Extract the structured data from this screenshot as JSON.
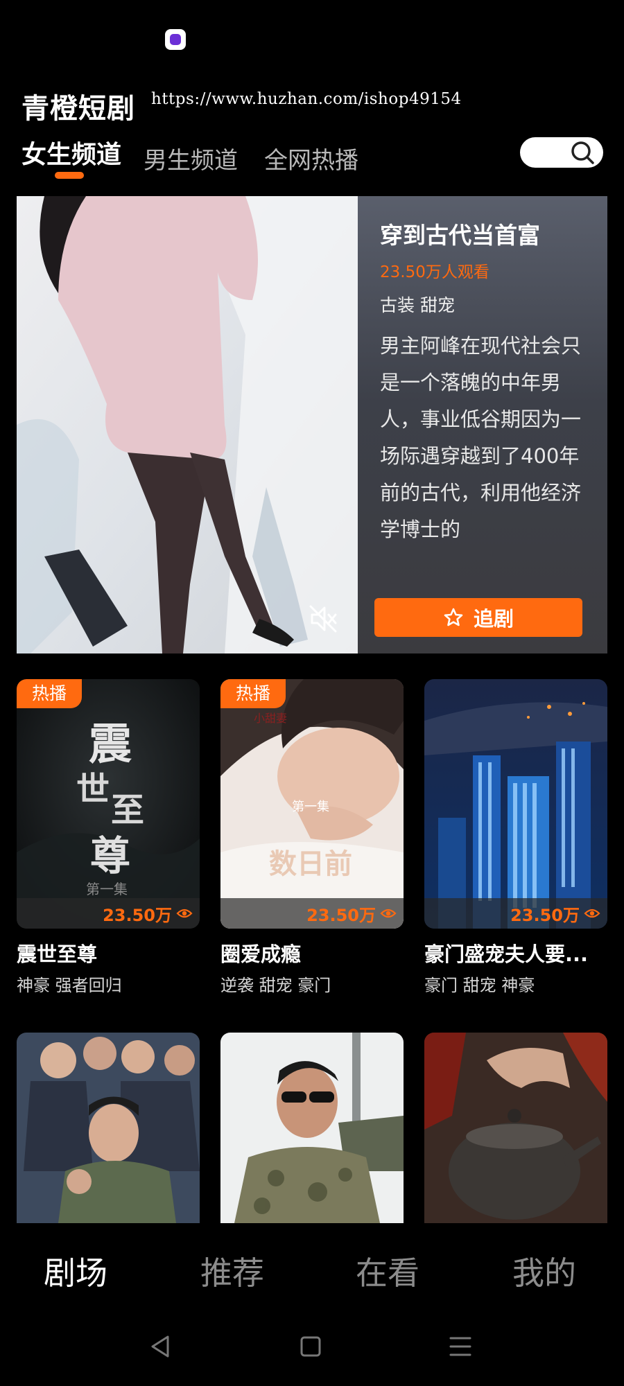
{
  "header": {
    "app_title": "青橙短剧",
    "url": "https://www.huzhan.com/ishop49154",
    "tabs": [
      {
        "label": "女生频道",
        "active": true
      },
      {
        "label": "男生频道",
        "active": false
      },
      {
        "label": "全网热播",
        "active": false
      }
    ]
  },
  "featured": {
    "title": "穿到古代当首富",
    "views": "23.50万人观看",
    "tags": "古装 甜宠",
    "description": "男主阿峰在现代社会只是一个落魄的中年男人，事业低谷期因为一场际遇穿越到了400年前的古代，利用他经济学博士的",
    "follow_label": "追剧"
  },
  "cards": [
    {
      "title": "震世至尊",
      "tags": "神豪 强者回归",
      "badge": "热播",
      "views": "23.50万",
      "poster_text": "震世至尊",
      "poster_sub": "第一集"
    },
    {
      "title": "圈爱成瘾",
      "tags": "逆袭 甜宠 豪门",
      "badge": "热播",
      "views": "23.50万",
      "poster_text": "数日前",
      "poster_sub": "第一集"
    },
    {
      "title": "豪门盛宠夫人要...",
      "tags": "豪门 甜宠 神豪",
      "badge": "",
      "views": "23.50万"
    },
    {
      "title": "",
      "tags": "",
      "badge": "",
      "views": ""
    },
    {
      "title": "",
      "tags": "",
      "badge": "",
      "views": ""
    },
    {
      "title": "",
      "tags": "",
      "badge": "",
      "views": ""
    }
  ],
  "bottom_nav": [
    {
      "label": "剧场",
      "active": true
    },
    {
      "label": "推荐",
      "active": false
    },
    {
      "label": "在看",
      "active": false
    },
    {
      "label": "我的",
      "active": false
    }
  ],
  "colors": {
    "accent": "#ff6a10",
    "background": "#000000"
  },
  "icons": [
    "search-icon",
    "mute-icon",
    "star-icon",
    "eye-icon",
    "back-icon",
    "home-icon",
    "menu-icon"
  ]
}
